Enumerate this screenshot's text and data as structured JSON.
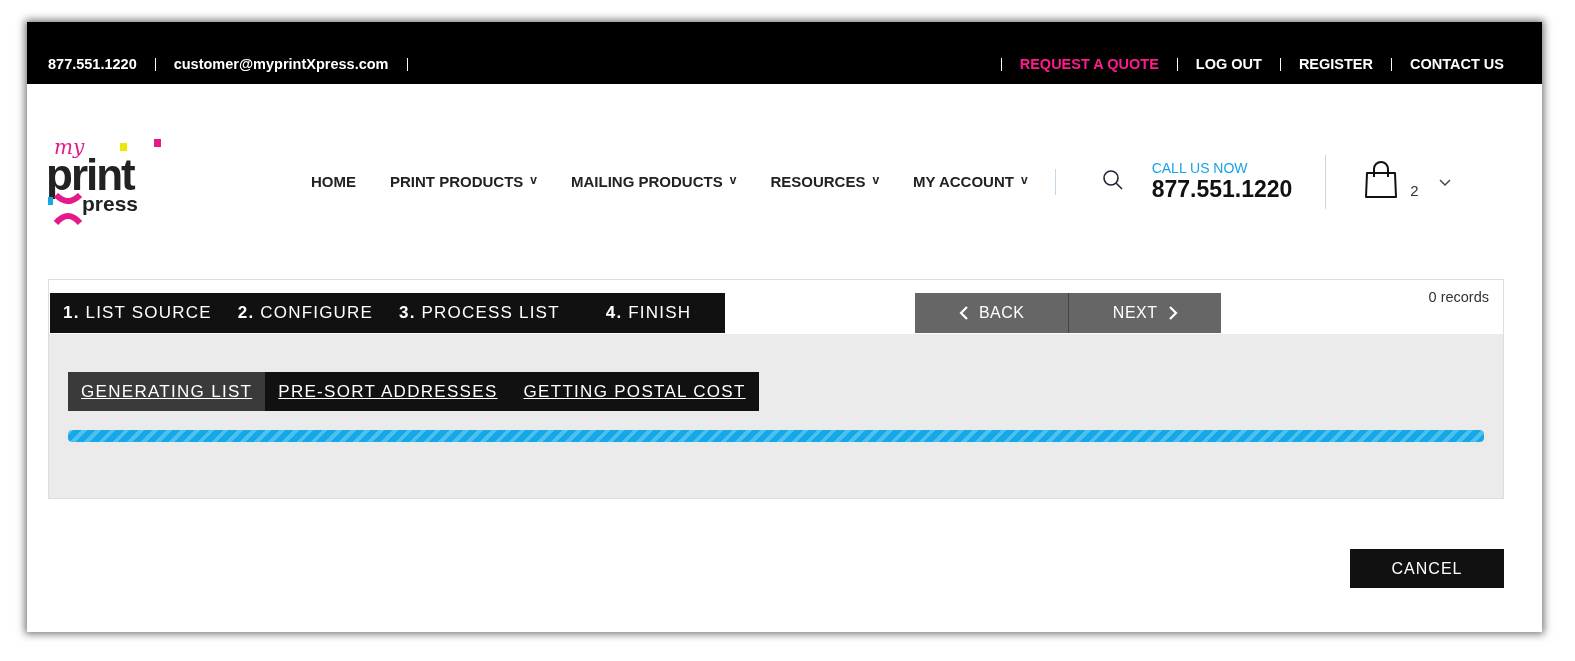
{
  "top_bar": {
    "phone": "877.551.1220",
    "email": "customer@myprintXpress.com",
    "links": [
      {
        "label": "REQUEST A QUOTE",
        "kind": "highlight"
      },
      {
        "label": "LOG OUT",
        "kind": "plain"
      },
      {
        "label": "REGISTER",
        "kind": "plain"
      },
      {
        "label": "CONTACT US",
        "kind": "plain"
      }
    ]
  },
  "logo": {
    "line_1": "my",
    "line_2": "print",
    "line_3": "press"
  },
  "nav": [
    {
      "label": "HOME"
    },
    {
      "label": "PRINT PRODUCTS",
      "caret": "v"
    },
    {
      "label": "MAILING PRODUCTS",
      "caret": "v"
    },
    {
      "label": "RESOURCES",
      "caret": "v"
    },
    {
      "label": "MY ACCOUNT",
      "caret": "v"
    }
  ],
  "call": {
    "label": "CALL US NOW",
    "phone": "877.551.1220"
  },
  "cart": {
    "count": "2"
  },
  "wizard": {
    "steps": [
      "**1.** LIST SOURCE",
      "**2.** CONFIGURE",
      "**3.** PROCESS LIST",
      "**4.** FINISH"
    ],
    "back": "BACK",
    "next": "NEXT",
    "records": "0 records",
    "tasks": [
      {
        "label": "GENERATING LIST",
        "selected": true
      },
      {
        "label": "PRE-SORT ADDRESSES",
        "selected": false
      },
      {
        "label": "GETTING POSTAL COST",
        "selected": false
      }
    ],
    "progress": {
      "level": 1
    }
  },
  "cancel": "CANCEL"
}
